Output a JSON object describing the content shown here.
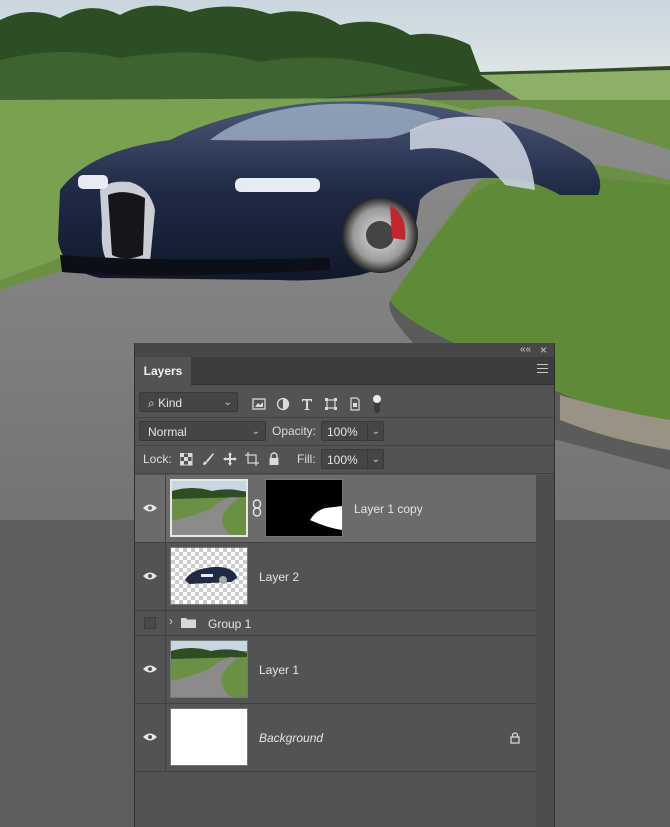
{
  "panel": {
    "collapse_glyph": "««",
    "close_glyph": "×",
    "tab_label": "Layers"
  },
  "filter": {
    "kind_label": "Kind",
    "search_glyph": "⌕"
  },
  "blend": {
    "mode": "Normal",
    "opacity_label": "Opacity:",
    "opacity_value": "100%"
  },
  "lock": {
    "label": "Lock:",
    "fill_label": "Fill:",
    "fill_value": "100%"
  },
  "layers": [
    {
      "name": "Layer 1 copy",
      "visible": true,
      "selected": true,
      "has_mask": true
    },
    {
      "name": "Layer 2",
      "visible": true,
      "selected": false
    },
    {
      "name": "Group 1",
      "visible": false,
      "type": "group"
    },
    {
      "name": "Layer 1",
      "visible": true,
      "selected": false
    },
    {
      "name": "Background",
      "visible": true,
      "locked": true,
      "italic": true
    }
  ],
  "colors": {
    "panel_bg": "#535353",
    "selected_row": "#6b6b6b",
    "car_body": "#1f2a44"
  },
  "icons": {
    "eye": "eye-icon",
    "lock": "lock-icon",
    "folder": "folder-icon",
    "link": "chain-link-icon"
  }
}
